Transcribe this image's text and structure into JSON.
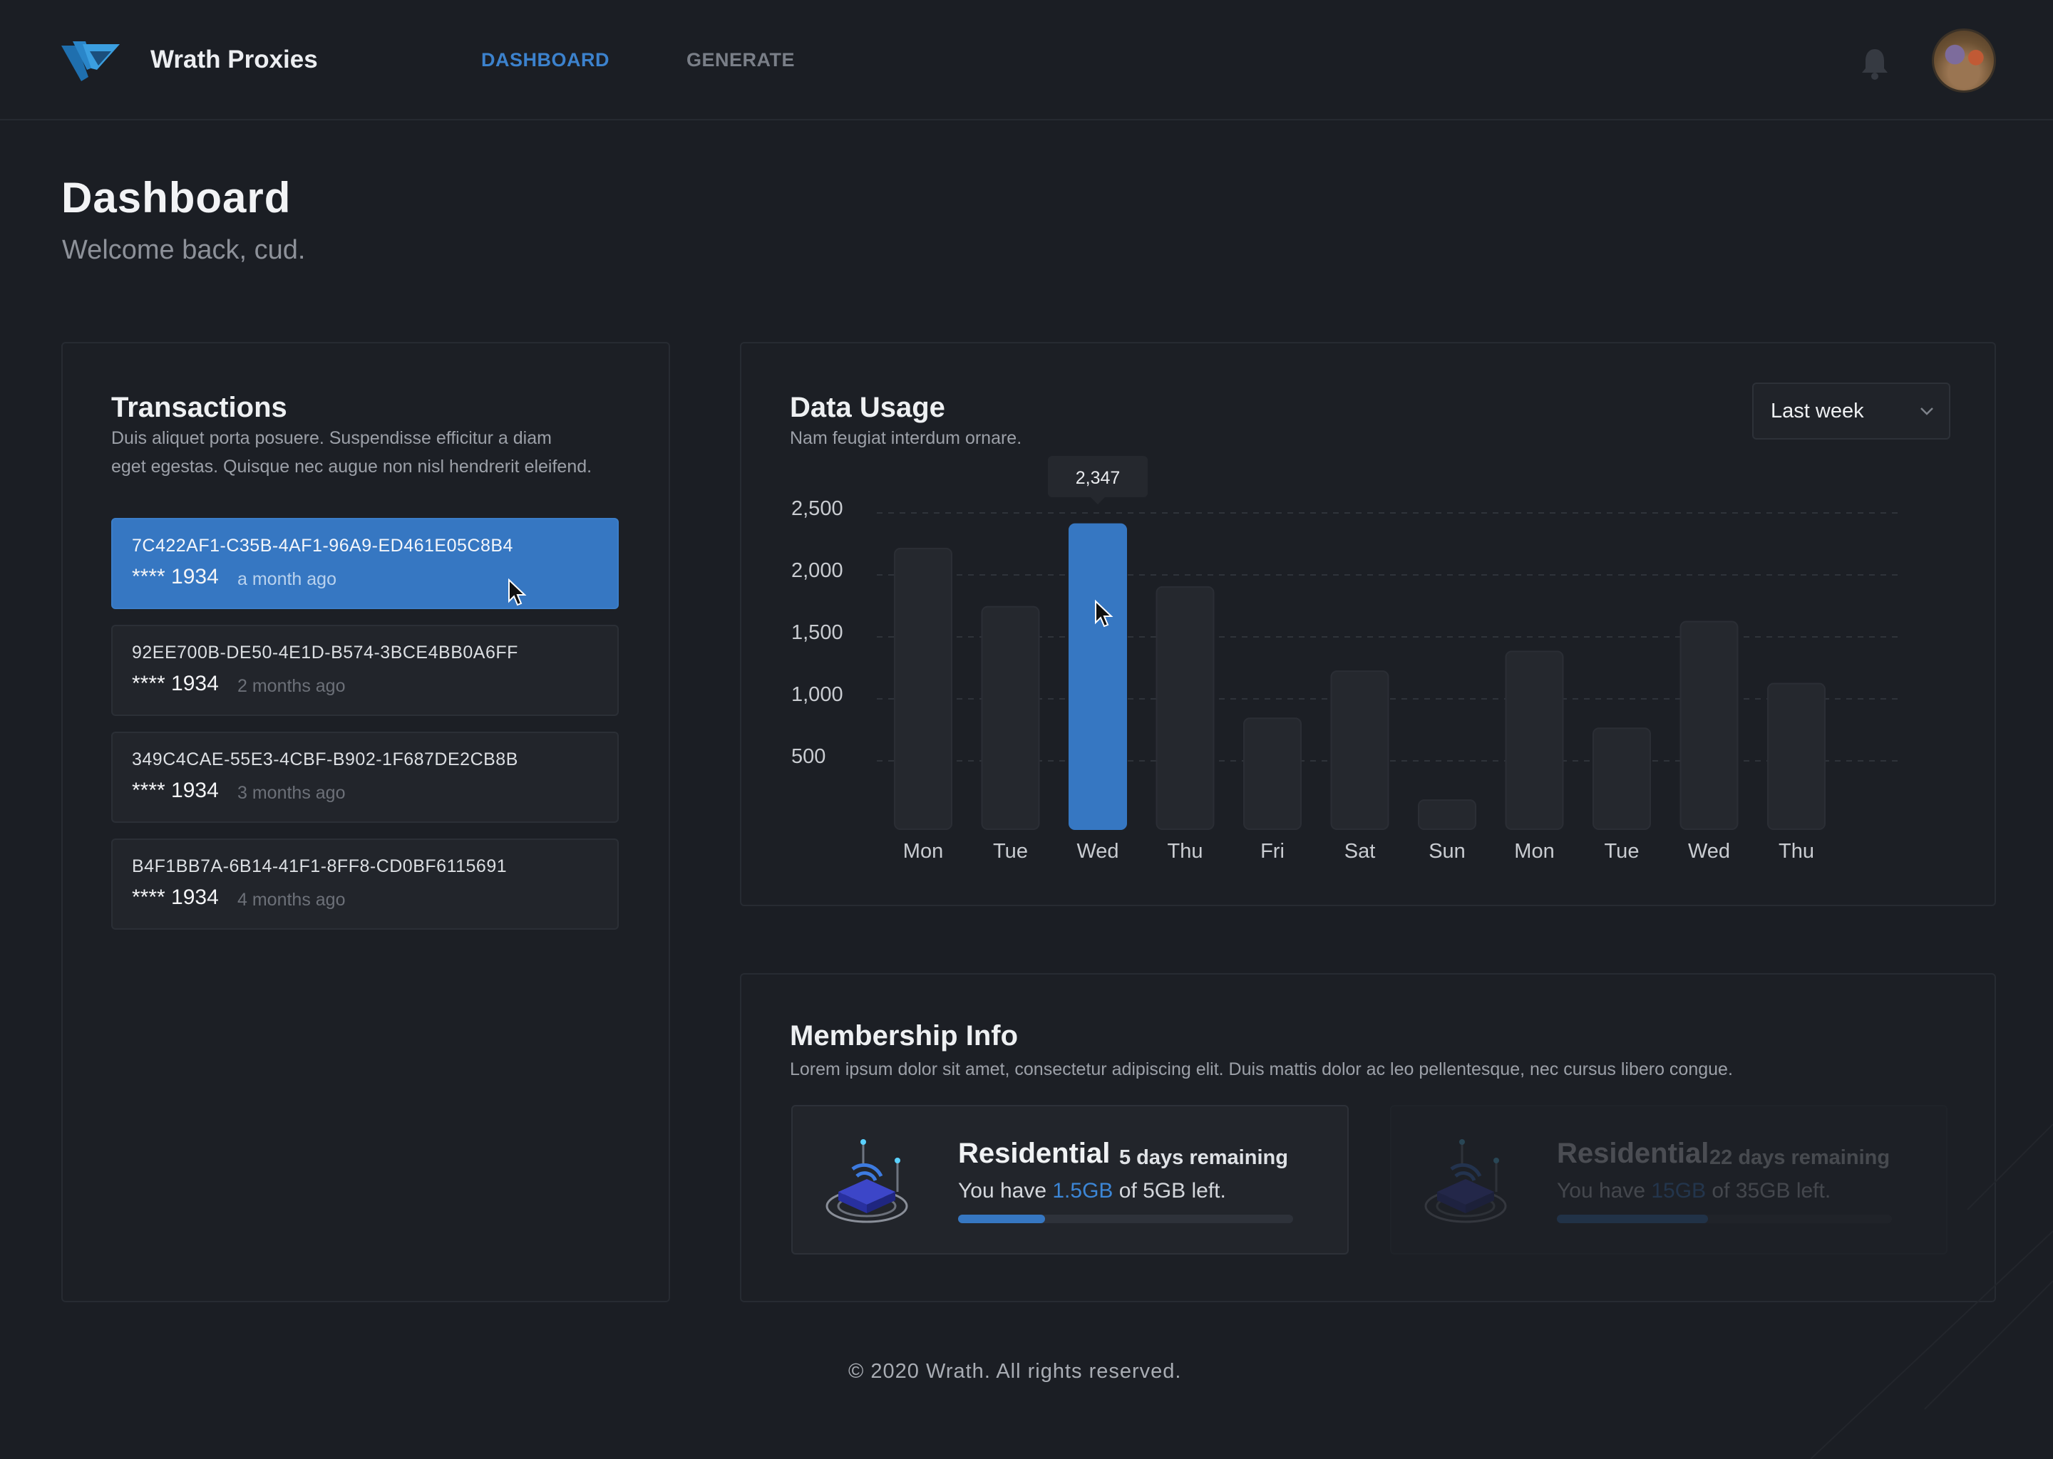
{
  "header": {
    "brand": "Wrath Proxies",
    "nav": [
      {
        "label": "DASHBOARD",
        "active": true
      },
      {
        "label": "GENERATE",
        "active": false
      }
    ],
    "icons": [
      "logo",
      "bell-icon",
      "avatar"
    ]
  },
  "page": {
    "title": "Dashboard",
    "subtitle": "Welcome back, cud."
  },
  "transactions": {
    "title": "Transactions",
    "description_line1": "Duis aliquet porta posuere. Suspendisse efficitur a diam",
    "description_line2": "eget egestas. Quisque nec augue non nisl hendrerit eleifend.",
    "items": [
      {
        "id": "7C422AF1-C35B-4AF1-96A9-ED461E05C8B4",
        "card": "**** 1934",
        "time": "a month ago",
        "selected": true
      },
      {
        "id": "92EE700B-DE50-4E1D-B574-3BCE4BB0A6FF",
        "card": "**** 1934",
        "time": "2 months ago",
        "selected": false
      },
      {
        "id": "349C4CAE-55E3-4CBF-B902-1F687DE2CB8B",
        "card": "**** 1934",
        "time": "3 months ago",
        "selected": false
      },
      {
        "id": "B4F1BB7A-6B14-41F1-8FF8-CD0BF6115691",
        "card": "**** 1934",
        "time": "4 months ago",
        "selected": false
      }
    ]
  },
  "data_usage": {
    "title": "Data Usage",
    "description": "Nam feugiat interdum ornare.",
    "range_select": "Last week",
    "tooltip": "2,347"
  },
  "chart_data": {
    "type": "bar",
    "categories": [
      "Mon",
      "Tue",
      "Wed",
      "Thu",
      "Fri",
      "Sat",
      "Sun",
      "Mon",
      "Tue",
      "Wed",
      "Thu"
    ],
    "values": [
      2150,
      1680,
      2347,
      1840,
      780,
      1160,
      120,
      1320,
      700,
      1560,
      1060
    ],
    "highlighted_index": 2,
    "y_ticks": [
      "2,500",
      "2,000",
      "1,500",
      "1,000",
      "500"
    ],
    "y_tick_values": [
      2500,
      2000,
      1500,
      1000,
      500
    ],
    "ylim": [
      0,
      2600
    ],
    "grid": true,
    "colors": {
      "bar": "#25282e",
      "highlight": "#3677c2",
      "grid": "#2f333a"
    }
  },
  "membership": {
    "title": "Membership Info",
    "description": "Lorem ipsum dolor sit amet, consectetur adipiscing elit. Duis mattis dolor ac leo pellentesque, nec cursus libero congue.",
    "plans": [
      {
        "name": "Residential",
        "remaining": "5 days remaining",
        "usage_prefix": "You have ",
        "left": "1.5GB",
        "usage_suffix": " of 5GB left.",
        "progress": 0.26,
        "active": true
      },
      {
        "name": "Residential",
        "remaining": "22 days remaining",
        "usage_prefix": "You have ",
        "left": "15GB",
        "usage_suffix": " of 35GB left.",
        "progress": 0.45,
        "active": false
      }
    ]
  },
  "footer": {
    "text": "© 2020 Wrath. All rights reserved."
  },
  "colors": {
    "accent": "#3677c2",
    "background": "#1b1e24",
    "card": "#1c1f25"
  }
}
